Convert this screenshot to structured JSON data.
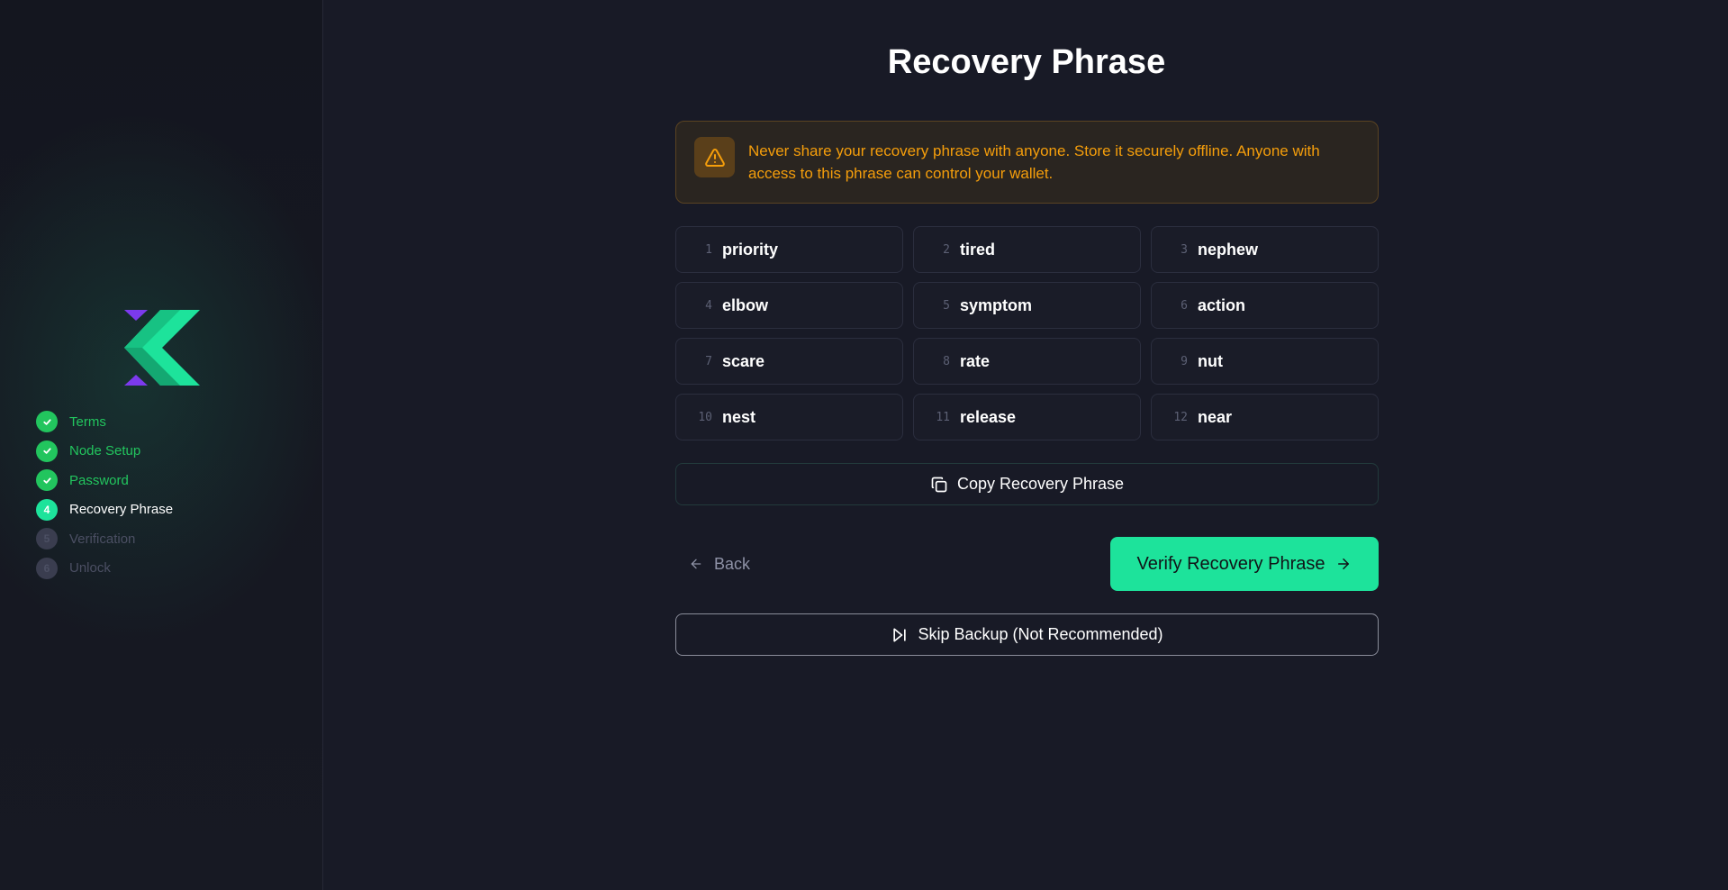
{
  "sidebar": {
    "steps": [
      {
        "number": "1",
        "label": "Terms",
        "status": "done"
      },
      {
        "number": "2",
        "label": "Node Setup",
        "status": "done"
      },
      {
        "number": "3",
        "label": "Password",
        "status": "done"
      },
      {
        "number": "4",
        "label": "Recovery Phrase",
        "status": "active"
      },
      {
        "number": "5",
        "label": "Verification",
        "status": "pending"
      },
      {
        "number": "6",
        "label": "Unlock",
        "status": "pending"
      }
    ]
  },
  "main": {
    "title": "Recovery Phrase",
    "warning": "Never share your recovery phrase with anyone. Store it securely offline. Anyone with access to this phrase can control your wallet.",
    "words": [
      {
        "index": "1",
        "word": "priority"
      },
      {
        "index": "2",
        "word": "tired"
      },
      {
        "index": "3",
        "word": "nephew"
      },
      {
        "index": "4",
        "word": "elbow"
      },
      {
        "index": "5",
        "word": "symptom"
      },
      {
        "index": "6",
        "word": "action"
      },
      {
        "index": "7",
        "word": "scare"
      },
      {
        "index": "8",
        "word": "rate"
      },
      {
        "index": "9",
        "word": "nut"
      },
      {
        "index": "10",
        "word": "nest"
      },
      {
        "index": "11",
        "word": "release"
      },
      {
        "index": "12",
        "word": "near"
      }
    ],
    "copy_label": "Copy Recovery Phrase",
    "back_label": "Back",
    "verify_label": "Verify Recovery Phrase",
    "skip_label": "Skip Backup (Not Recommended)"
  },
  "colors": {
    "accent": "#1de39b",
    "done": "#22c55e",
    "warning": "#f59e0b",
    "logo_purple": "#7c3aed"
  }
}
